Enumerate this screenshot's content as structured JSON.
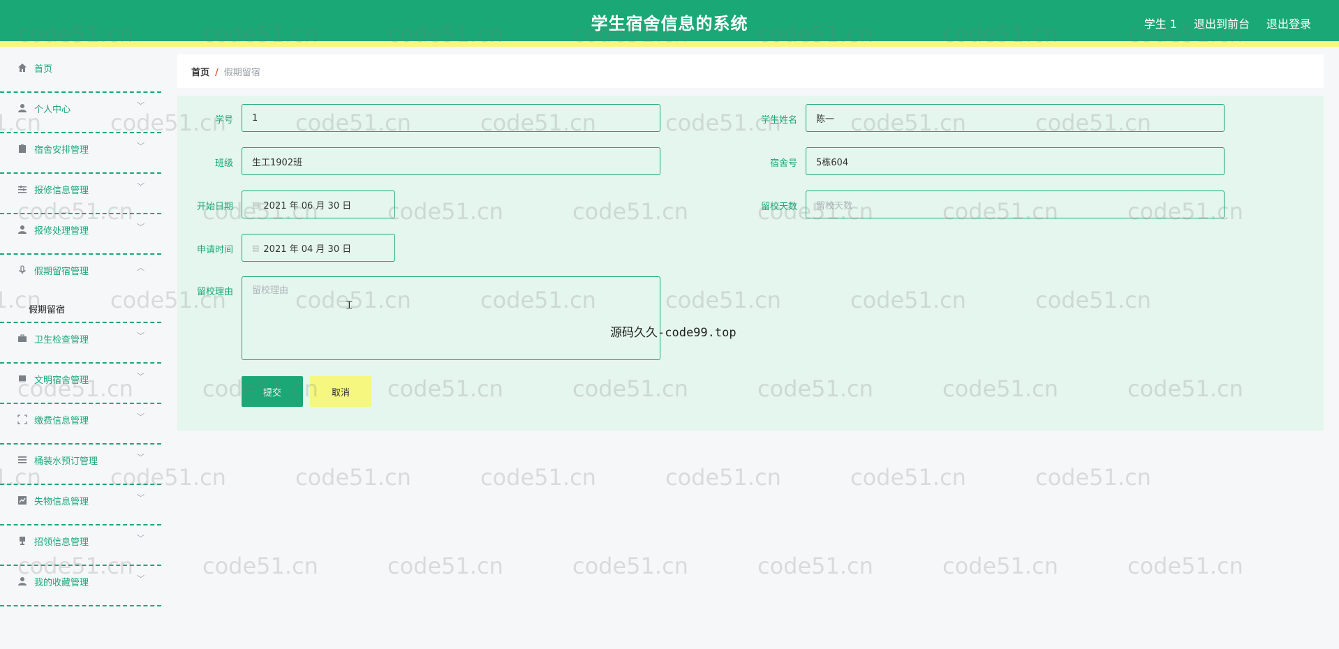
{
  "header": {
    "title": "学生宿舍信息的系统",
    "user": "学生 1",
    "back_to_front": "退出到前台",
    "logout": "退出登录"
  },
  "sidebar": {
    "items": [
      {
        "label": "首页",
        "icon": "home-icon"
      },
      {
        "label": "个人中心",
        "icon": "user-icon"
      },
      {
        "label": "宿舍安排管理",
        "icon": "clipboard-icon"
      },
      {
        "label": "报修信息管理",
        "icon": "sliders-icon"
      },
      {
        "label": "报修处理管理",
        "icon": "user-icon"
      },
      {
        "label": "假期留宿管理",
        "icon": "microphone-icon"
      },
      {
        "label": "卫生检查管理",
        "icon": "briefcase-icon"
      },
      {
        "label": "文明宿舍管理",
        "icon": "book-icon"
      },
      {
        "label": "缴费信息管理",
        "icon": "expand-icon"
      },
      {
        "label": "桶装水预订管理",
        "icon": "list-icon"
      },
      {
        "label": "失物信息管理",
        "icon": "chart-icon"
      },
      {
        "label": "招领信息管理",
        "icon": "trophy-icon"
      },
      {
        "label": "我的收藏管理",
        "icon": "user-icon"
      }
    ],
    "submenu_label": "假期留宿"
  },
  "breadcrumb": {
    "home": "首页",
    "separator": "/",
    "current": "假期留宿"
  },
  "form": {
    "student_id_label": "学号",
    "student_id_value": "1",
    "student_name_label": "学生姓名",
    "student_name_value": "陈一",
    "class_label": "班级",
    "class_value": "生工1902班",
    "dorm_label": "宿舍号",
    "dorm_value": "5栋604",
    "start_date_label": "开始日期",
    "start_date_value": "2021 年 06 月 30 日",
    "stay_days_label": "留校天数",
    "stay_days_placeholder": "留校天数",
    "apply_time_label": "申请时间",
    "apply_time_value": "2021 年 04 月 30 日",
    "reason_label": "留校理由",
    "reason_placeholder": "留校理由",
    "submit": "提交",
    "cancel": "取消"
  },
  "overlay_text": "源码久久-code99.top",
  "watermark_text": "code51.cn",
  "colors": {
    "primary": "#1ba877",
    "accent_yellow": "#f5f77e",
    "panel_bg": "#e4f6ee"
  }
}
